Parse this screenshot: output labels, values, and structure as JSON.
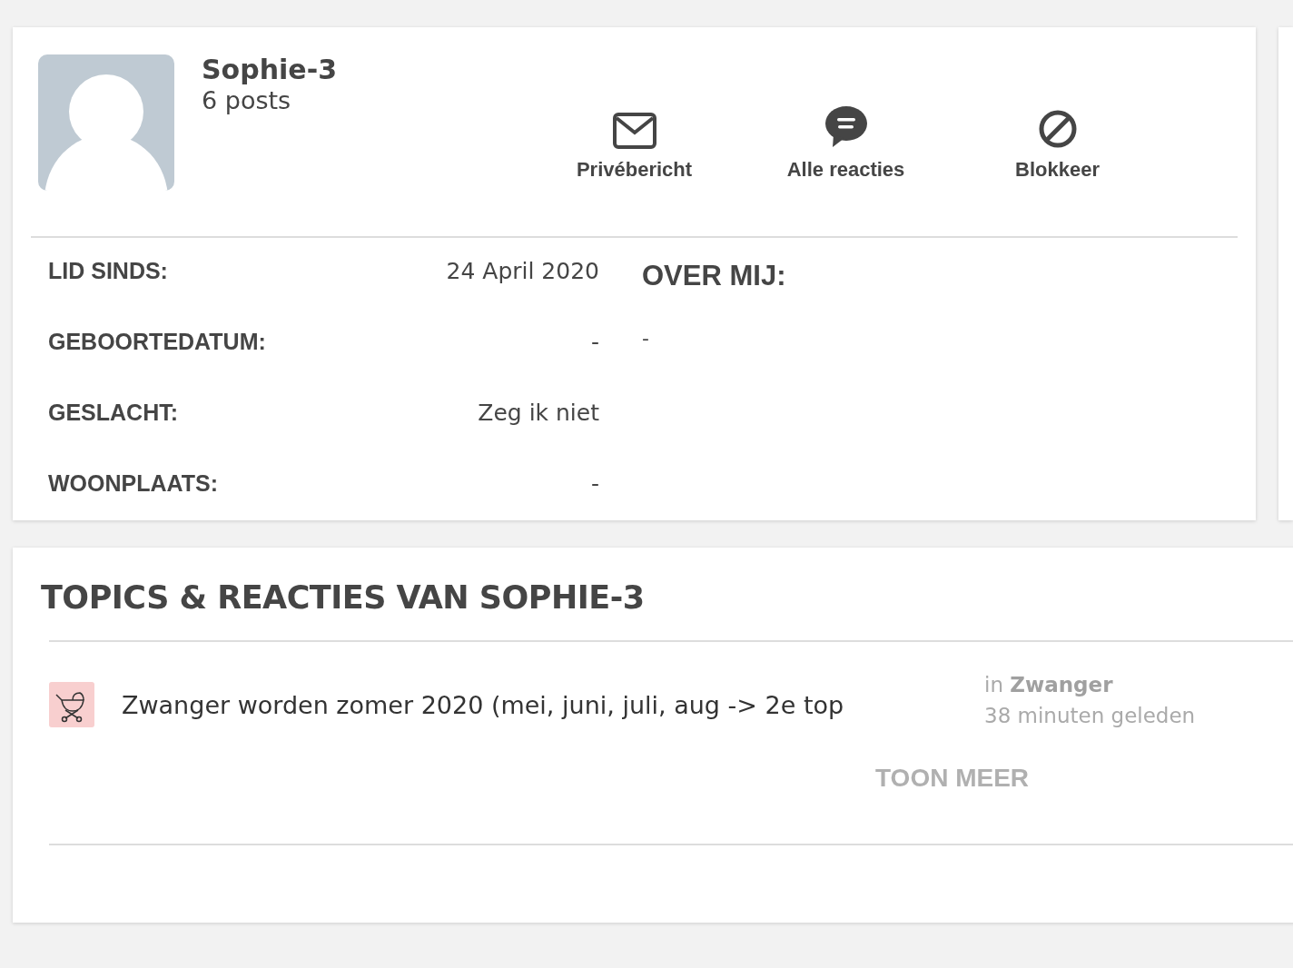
{
  "profile": {
    "name": "Sophie-3",
    "posts": "6 posts"
  },
  "actions": [
    {
      "kind": "mail",
      "label": "Privébericht"
    },
    {
      "kind": "comments",
      "label": "Alle reacties"
    },
    {
      "kind": "block",
      "label": "Blokkeer"
    }
  ],
  "details": [
    {
      "label": "LID SINDS:",
      "value": "24 April 2020"
    },
    {
      "label": "GEBOORTEDATUM:",
      "value": "-"
    },
    {
      "label": "GESLACHT:",
      "value": "Zeg ik niet"
    },
    {
      "label": "WOONPLAATS:",
      "value": "-"
    }
  ],
  "about": {
    "title": "OVER MIJ:",
    "text": "-"
  },
  "topics": {
    "title": "TOPICS & REACTIES VAN SOPHIE-3",
    "items": [
      {
        "title": "Zwanger worden zomer 2020 (mei, juni, juli, aug -> 2e top",
        "category": "in **Zwanger**",
        "time": "38 minuten geleden"
      }
    ],
    "more": "TOON MEER"
  }
}
